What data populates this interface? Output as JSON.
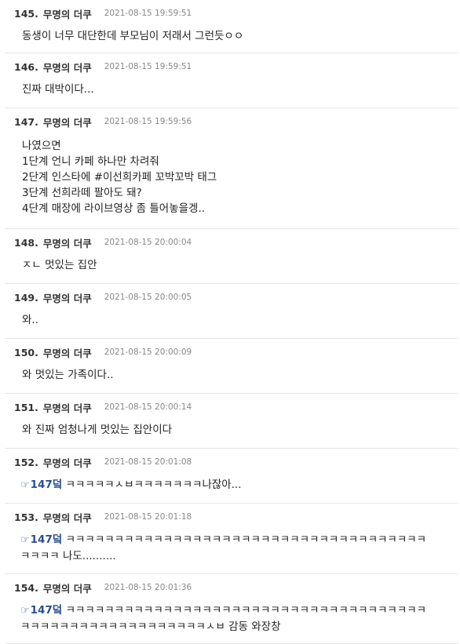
{
  "posts": [
    {
      "number": "145.",
      "author": "무명의 더쿠",
      "time": "2021-08-15 19:59:51",
      "lines": [
        "동생이 너무 대단한데 부모님이 저래서 그런듯ㅇㅇ"
      ]
    },
    {
      "number": "146.",
      "author": "무명의 더쿠",
      "time": "2021-08-15 19:59:51",
      "lines": [
        "진짜 대박이다..."
      ]
    },
    {
      "number": "147.",
      "author": "무명의 더쿠",
      "time": "2021-08-15 19:59:56",
      "lines": [
        "나였으면",
        "1단계 언니 카페 하나만 차려줘",
        "2단계 인스타에 #이선희카페 꼬박꼬박 태그",
        "3단계 선희라떼 팔아도 돼?",
        "4단계 매장에 라이브영상 좀 틀어놓을겡.."
      ]
    },
    {
      "number": "148.",
      "author": "무명의 더쿠",
      "time": "2021-08-15 20:00:04",
      "lines": [
        "ㅈㄴ 멋있는 집안"
      ]
    },
    {
      "number": "149.",
      "author": "무명의 더쿠",
      "time": "2021-08-15 20:00:05",
      "lines": [
        "와.."
      ]
    },
    {
      "number": "150.",
      "author": "무명의 더쿠",
      "time": "2021-08-15 20:00:09",
      "lines": [
        "와 멋있는 가족이다.."
      ]
    },
    {
      "number": "151.",
      "author": "무명의 더쿠",
      "time": "2021-08-15 20:00:14",
      "lines": [
        "와 진짜 엄청나게 멋있는 집안이다"
      ]
    },
    {
      "number": "152.",
      "author": "무명의 더쿠",
      "time": "2021-08-15 20:01:08",
      "reply_to": "147덬",
      "reply_icon": "pointing-hand-icon",
      "lines": [
        "ㅋㅋㅋㅋㅋㅅㅂㅋㅋㅋㅋㅋㅋㅋ나잖아..."
      ]
    },
    {
      "number": "153.",
      "author": "무명의 더쿠",
      "time": "2021-08-15 20:01:18",
      "reply_to": "147덬",
      "reply_icon": "pointing-hand-icon",
      "lines": [
        "ㅋㅋㅋㅋㅋㅋㅋㅋㅋㅋㅋㅋㅋㅋㅋㅋㅋㅋㅋㅋㅋㅋㅋㅋㅋㅋㅋㅋㅋㅋㅋㅋㅋㅋㅋㅋㅋ",
        "ㅋㅋㅋㅋ 나도.........."
      ]
    },
    {
      "number": "154.",
      "author": "무명의 더쿠",
      "time": "2021-08-15 20:01:36",
      "reply_to": "147덬",
      "reply_icon": "pointing-hand-icon",
      "lines": [
        "ㅋㅋㅋㅋㅋㅋㅋㅋㅋㅋㅋㅋㅋㅋㅋㅋㅋㅋㅋㅋㅋㅋㅋㅋㅋㅋㅋㅋㅋㅋㅋㅋㅋㅋㅋㅋㅋ",
        "ㅋㅋㅋㅋㅋㅋㅋㅋㅋㅋㅋㅋㅋㅋㅋㅋㅋㅋㅋㅅㅂ 감동 와장창"
      ]
    }
  ]
}
